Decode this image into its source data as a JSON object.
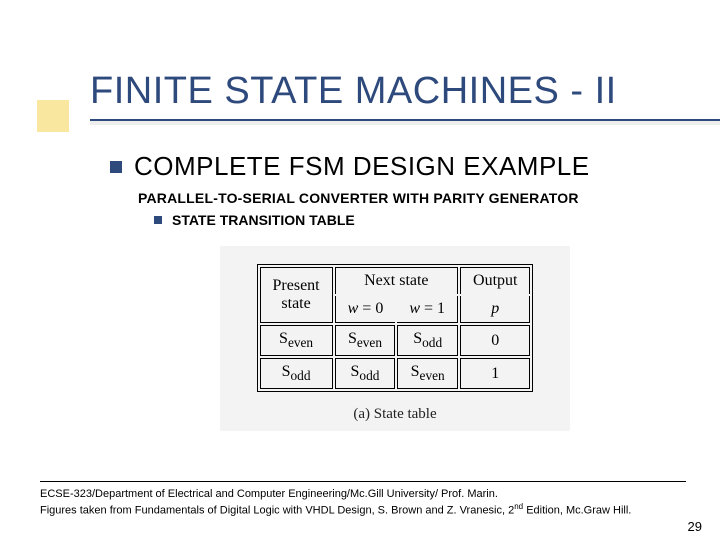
{
  "title": "FINITE STATE MACHINES - II",
  "heading2": "COMPLETE FSM DESIGN EXAMPLE",
  "subheading": "PARALLEL-TO-SERIAL CONVERTER WITH PARITY GENERATOR",
  "subbullet": "STATE TRANSITION TABLE",
  "table": {
    "col_present": "Present\nstate",
    "col_next": "Next state",
    "col_w0": "w = 0",
    "col_w1": "w = 1",
    "col_output": "Output",
    "col_p": "p",
    "rows": [
      {
        "present": "Sₑᵥₑₙ",
        "w0": "Sₑᵥₑₙ",
        "w1": "Sₒdd",
        "p": "0"
      },
      {
        "present": "Sₒdd",
        "w0": "Sₒdd",
        "w1": "Sₑᵥₑₙ",
        "p": "1"
      }
    ]
  },
  "caption": "(a) State table",
  "footer_line1": "ECSE-323/Department of Electrical and Computer Engineering/Mc.Gill University/ Prof. Marin.",
  "footer_line2_a": "Figures taken from Fundamentals of Digital Logic with VHDL Design, S. Brown and Z. Vranesic, 2",
  "footer_line2_sup": "nd",
  "footer_line2_b": " Edition, Mc.Graw Hill.",
  "page_number": "29"
}
